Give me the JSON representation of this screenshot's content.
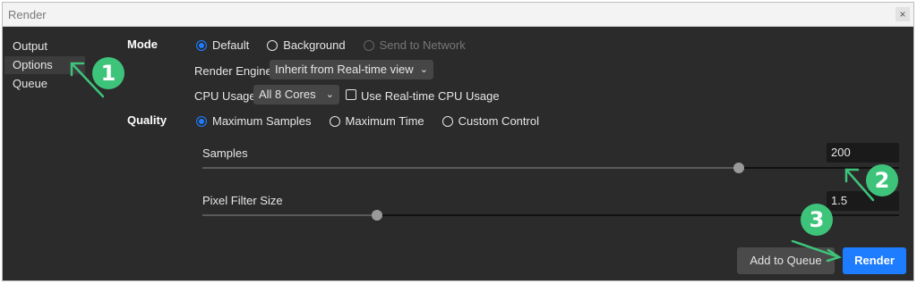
{
  "window": {
    "title": "Render",
    "close_glyph": "×"
  },
  "sidebar": {
    "items": [
      {
        "label": "Output"
      },
      {
        "label": "Options",
        "active": true
      },
      {
        "label": "Queue"
      }
    ]
  },
  "mode": {
    "section_label": "Mode",
    "options": [
      {
        "label": "Default",
        "selected": true
      },
      {
        "label": "Background",
        "selected": false
      },
      {
        "label": "Send to Network",
        "disabled": true
      }
    ]
  },
  "render_engine": {
    "label": "Render Engine",
    "value": "Inherit from Real-time view"
  },
  "cpu_usage": {
    "label": "CPU Usage",
    "value": "All 8 Cores",
    "checkbox_label": "Use Real-time CPU Usage",
    "checked": false
  },
  "quality": {
    "section_label": "Quality",
    "options": [
      {
        "label": "Maximum Samples",
        "selected": true
      },
      {
        "label": "Maximum Time",
        "selected": false
      },
      {
        "label": "Custom Control",
        "selected": false
      }
    ]
  },
  "samples": {
    "label": "Samples",
    "value": "200",
    "level": 0.77
  },
  "pixel_filter": {
    "label": "Pixel Filter Size",
    "value": "1.5",
    "level": 0.25
  },
  "buttons": {
    "add_to_queue": "Add to Queue",
    "render": "Render"
  },
  "annotations": {
    "badge_1": "1",
    "badge_2": "2",
    "badge_3": "3",
    "accent": "#3ec47a"
  }
}
